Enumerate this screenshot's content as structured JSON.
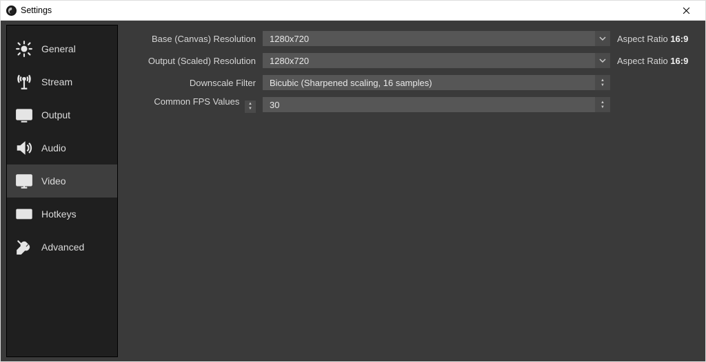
{
  "window": {
    "title": "Settings"
  },
  "sidebar": {
    "items": [
      {
        "id": "general",
        "label": "General"
      },
      {
        "id": "stream",
        "label": "Stream"
      },
      {
        "id": "output",
        "label": "Output"
      },
      {
        "id": "audio",
        "label": "Audio"
      },
      {
        "id": "video",
        "label": "Video"
      },
      {
        "id": "hotkeys",
        "label": "Hotkeys"
      },
      {
        "id": "advanced",
        "label": "Advanced"
      }
    ],
    "active": "video"
  },
  "video": {
    "base_label": "Base (Canvas) Resolution",
    "base_value": "1280x720",
    "base_aspect_prefix": "Aspect Ratio ",
    "base_aspect_value": "16:9",
    "output_label": "Output (Scaled) Resolution",
    "output_value": "1280x720",
    "output_aspect_prefix": "Aspect Ratio ",
    "output_aspect_value": "16:9",
    "filter_label": "Downscale Filter",
    "filter_value": "Bicubic (Sharpened scaling, 16 samples)",
    "fps_label": "Common FPS Values",
    "fps_value": "30"
  }
}
